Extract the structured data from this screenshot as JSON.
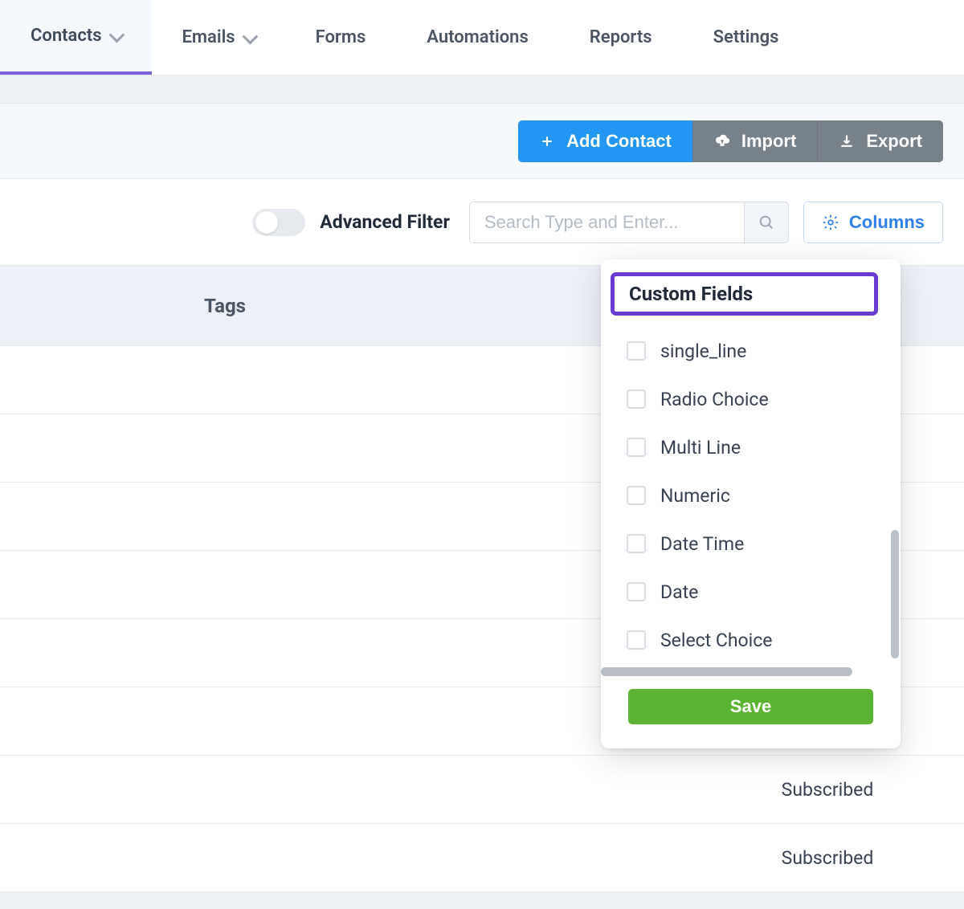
{
  "nav": {
    "tabs": [
      {
        "label": "Contacts",
        "has_dropdown": true,
        "active": true
      },
      {
        "label": "Emails",
        "has_dropdown": true,
        "active": false
      },
      {
        "label": "Forms",
        "has_dropdown": false,
        "active": false
      },
      {
        "label": "Automations",
        "has_dropdown": false,
        "active": false
      },
      {
        "label": "Reports",
        "has_dropdown": false,
        "active": false
      },
      {
        "label": "Settings",
        "has_dropdown": false,
        "active": false
      }
    ]
  },
  "toolbar": {
    "add_contact_label": "Add Contact",
    "import_label": "Import",
    "export_label": "Export"
  },
  "filter": {
    "advanced_label": "Advanced Filter",
    "search_placeholder": "Search Type and Enter...",
    "columns_label": "Columns"
  },
  "table": {
    "columns": {
      "tags": "Tags"
    },
    "rows": [
      {
        "status": ""
      },
      {
        "status": ""
      },
      {
        "status": ""
      },
      {
        "status": ""
      },
      {
        "status": ""
      },
      {
        "status": ""
      },
      {
        "status": "Subscribed"
      },
      {
        "status": "Subscribed"
      }
    ]
  },
  "popover": {
    "title": "Custom Fields",
    "fields": [
      {
        "label": "single_line"
      },
      {
        "label": "Radio Choice"
      },
      {
        "label": "Multi Line"
      },
      {
        "label": "Numeric"
      },
      {
        "label": "Date Time"
      },
      {
        "label": "Date"
      },
      {
        "label": "Select Choice"
      }
    ],
    "save_label": "Save"
  },
  "colors": {
    "tab_active_border": "#7c62d6",
    "primary_button": "#2196f3",
    "secondary_button": "#78828a",
    "columns_accent": "#2f80ed",
    "save_green": "#5cb532",
    "highlight_border": "#6a3bd1"
  }
}
